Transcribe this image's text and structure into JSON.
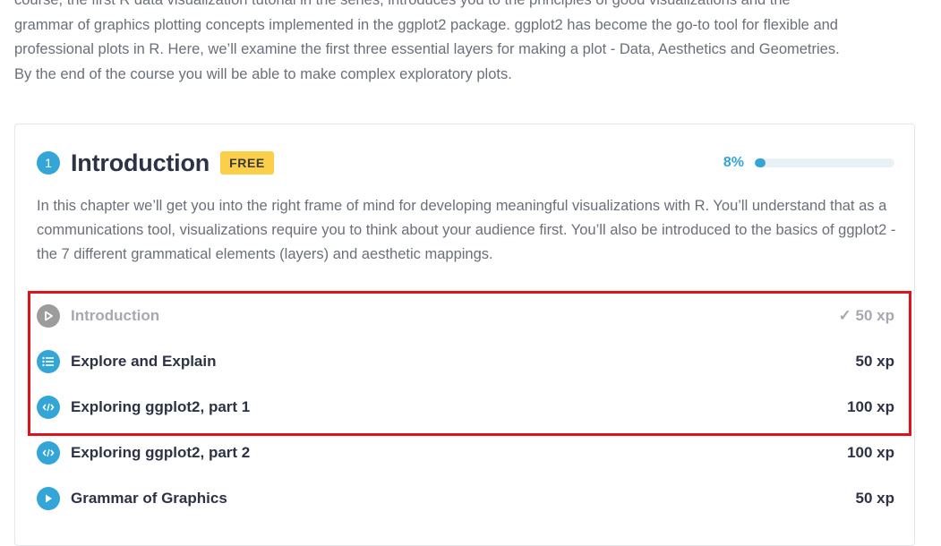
{
  "course_intro": {
    "lines": [
      "course, the first R data visualization tutorial in the series, introduces you to the principles of good visualizations and the",
      "grammar of graphics plotting concepts implemented in the ggplot2 package. ggplot2 has become the go-to tool for flexible and",
      "professional plots in R. Here, we’ll examine the first three essential layers for making a plot - Data, Aesthetics and Geometries.",
      "By the end of the course you will be able to make complex exploratory plots."
    ]
  },
  "chapter": {
    "number": "1",
    "title": "Introduction",
    "badge": "FREE",
    "progress_label": "8%",
    "progress_value": 0.08,
    "description": "In this chapter we’ll get you into the right frame of mind for developing meaningful visualizations with R. You’ll understand that as a communications tool, visualizations require you to think about your audience first. You’ll also be introduced to the basics of ggplot2 - the 7 different grammatical elements (layers) and aesthetic mappings.",
    "exercises": [
      {
        "title": "Introduction",
        "xp": "✓ 50 xp",
        "icon": "play-icon",
        "completed": true
      },
      {
        "title": "Explore and Explain",
        "xp": "50 xp",
        "icon": "list-icon",
        "completed": false
      },
      {
        "title": "Exploring ggplot2, part 1",
        "xp": "100 xp",
        "icon": "code-icon",
        "completed": false
      },
      {
        "title": "Exploring ggplot2, part 2",
        "xp": "100 xp",
        "icon": "code-icon",
        "completed": false
      },
      {
        "title": "Grammar of Graphics",
        "xp": "50 xp",
        "icon": "play-icon",
        "completed": false
      }
    ]
  },
  "colors": {
    "accent": "#33a5d6",
    "badge": "#fbcf4a",
    "completed": "#9c9c9c",
    "highlight": "#e0131c"
  }
}
